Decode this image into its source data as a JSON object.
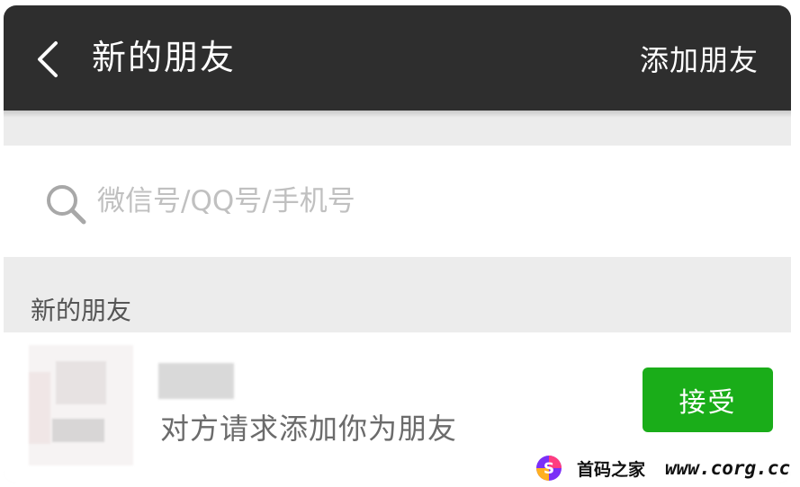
{
  "header": {
    "title": "新的朋友",
    "add_friend_label": "添加朋友"
  },
  "search": {
    "placeholder": "微信号/QQ号/手机号",
    "icon": "search-icon"
  },
  "section": {
    "label": "新的朋友"
  },
  "friend_request": {
    "message": "对方请求添加你为朋友",
    "accept_label": "接受"
  },
  "watermark": {
    "brand": "首码之家",
    "url": "www.corg.cc"
  },
  "colors": {
    "topbar": "#2e2e2e",
    "accent": "#1aad19",
    "background": "#ececec"
  }
}
